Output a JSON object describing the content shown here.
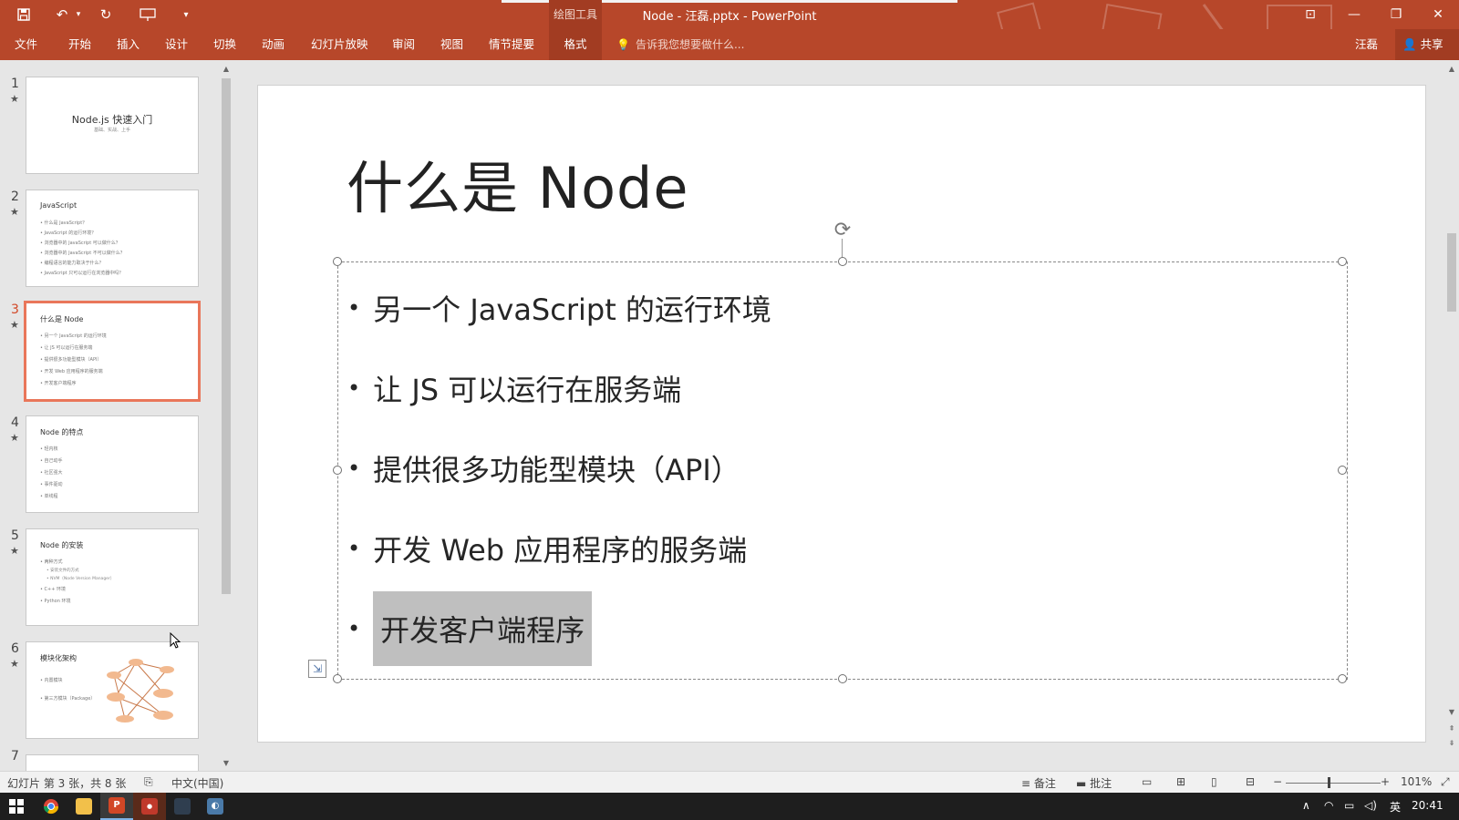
{
  "window": {
    "title": "Node - 汪磊.pptx - PowerPoint",
    "context_tool": "绘图工具"
  },
  "ribbon": {
    "tabs": [
      "文件",
      "开始",
      "插入",
      "设计",
      "切换",
      "动画",
      "幻灯片放映",
      "审阅",
      "视图",
      "情节提要",
      "格式"
    ],
    "active_tab": "格式",
    "tell_me": "告诉我您想要做什么...",
    "user": "汪磊",
    "share": "共享"
  },
  "thumbnails": [
    {
      "num": "1",
      "title": "Node.js 快速入门",
      "subtitle": "基础、实战、上手"
    },
    {
      "num": "2",
      "title": "JavaScript",
      "bullets": [
        "• 什么是 JavaScript？",
        "• JavaScript 的运行环境？",
        "• 浏览器中的 JavaScript 可以做什么？",
        "• 浏览器中的 JavaScript 不可以做什么？",
        "• 编程语言的能力取决于什么？",
        "• JavaScript 只可以运行在浏览器中吗？"
      ]
    },
    {
      "num": "3",
      "title": "什么是 Node",
      "bullets": [
        "• 另一个 JavaScript 的运行环境",
        "• 让 JS 可以运行在服务端",
        "• 提供很多功能型模块（API）",
        "• 开发 Web 应用程序的服务端",
        "• 开发客户端程序"
      ]
    },
    {
      "num": "4",
      "title": "Node 的特点",
      "bullets": [
        "• 轻内核",
        "• 自己动手",
        "• 社区强大",
        "• 事件驱动",
        "• 单线程"
      ]
    },
    {
      "num": "5",
      "title": "Node 的安装",
      "bullets": [
        "• 两种方式",
        "• C++ 环境",
        "• Python 环境"
      ],
      "sub_bullets": [
        "• 安装文件的方式",
        "• NVM（Node Version Manager）"
      ]
    },
    {
      "num": "6",
      "title": "模块化架构",
      "bullets": [
        "• 内置模块",
        "• 第三方模块（Package）"
      ]
    },
    {
      "num": "7"
    }
  ],
  "slide": {
    "title": "什么是 Node",
    "bullets": [
      "另一个 JavaScript 的运行环境",
      "让 JS 可以运行在服务端",
      "提供很多功能型模块（API）",
      "开发 Web 应用程序的服务端",
      "开发客户端程序"
    ],
    "highlighted_index": 4
  },
  "statusbar": {
    "slide_info": "幻灯片 第 3 张，共 8 张",
    "language": "中文(中国)",
    "notes": "备注",
    "comments": "批注",
    "zoom": "101%"
  },
  "taskbar": {
    "time": "20:41",
    "ime": "英"
  },
  "colors": {
    "accent": "#b7472a",
    "selected_thumb_border": "#e9765a",
    "highlight": "#bfbfbf"
  }
}
